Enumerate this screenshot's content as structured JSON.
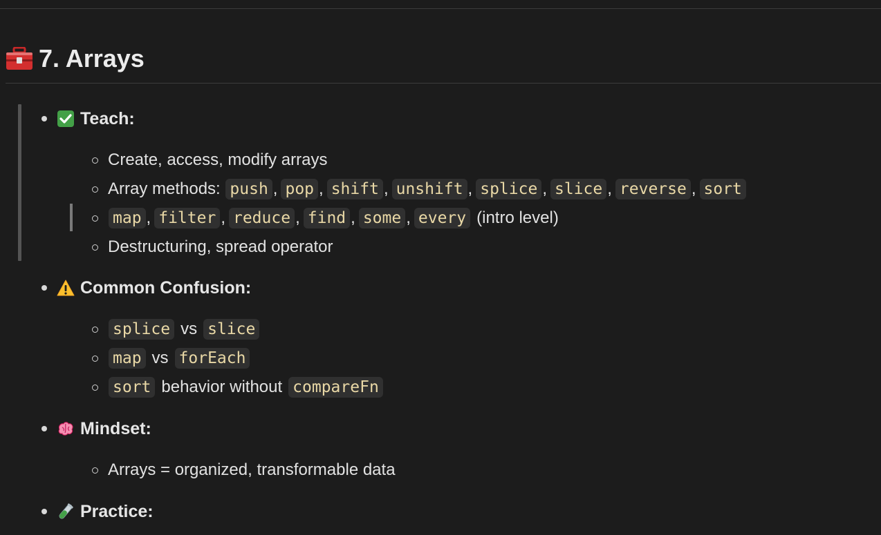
{
  "section": {
    "title": "7. Arrays",
    "icon": "toolbox-icon"
  },
  "teach": {
    "label": "Teach:",
    "icon": "check-box-icon",
    "items": {
      "create": "Create, access, modify arrays",
      "methods_prefix": "Array methods: ",
      "methods": [
        "push",
        "pop",
        "shift",
        "unshift",
        "splice",
        "slice",
        "reverse",
        "sort"
      ],
      "functional": [
        "map",
        "filter",
        "reduce",
        "find",
        "some",
        "every"
      ],
      "functional_suffix": "(intro level)",
      "destructuring": "Destructuring, spread operator"
    }
  },
  "confusion": {
    "label": "Common Confusion:",
    "icon": "warning-icon",
    "items": [
      {
        "a": "splice",
        "mid": "vs",
        "b": "slice"
      },
      {
        "a": "map",
        "mid": "vs",
        "b": "forEach"
      },
      {
        "a": "sort",
        "mid": "behavior without",
        "b": "compareFn"
      }
    ]
  },
  "mindset": {
    "label": "Mindset:",
    "icon": "brain-icon",
    "items": [
      "Arrays = organized, transformable data"
    ]
  },
  "practice": {
    "label": "Practice:",
    "icon": "test-tube-icon"
  },
  "colors": {
    "background": "#1c1c1c",
    "code_text": "#e9d8a6",
    "code_background": "#303030"
  }
}
